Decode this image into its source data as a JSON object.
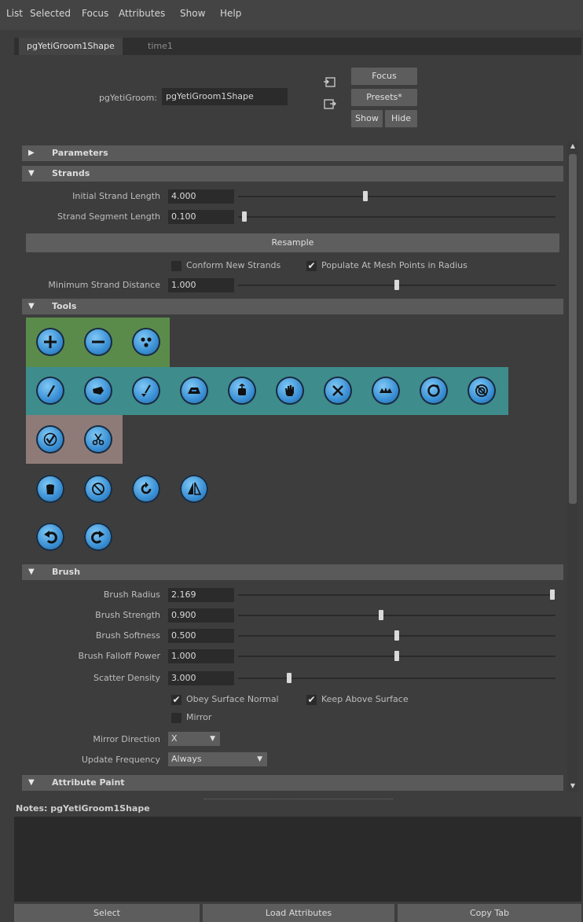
{
  "menu": [
    "List",
    "Selected",
    "Focus",
    "Attributes",
    "Show",
    "Help"
  ],
  "tabs": [
    "pgYetiGroom1Shape",
    "time1"
  ],
  "header": {
    "node_label": "pgYetiGroom:",
    "node_value": "pgYetiGroom1Shape",
    "focus": "Focus",
    "presets": "Presets*",
    "show": "Show",
    "hide": "Hide"
  },
  "sections": {
    "parameters": "Parameters",
    "strands": "Strands",
    "tools": "Tools",
    "brush": "Brush",
    "attribute_paint": "Attribute Paint"
  },
  "strands": {
    "initial_strand_length": {
      "label": "Initial Strand Length",
      "value": "4.000",
      "fraction": 0.4
    },
    "strand_segment_length": {
      "label": "Strand Segment Length",
      "value": "0.100",
      "fraction": 0.02
    },
    "resample": "Resample",
    "conform_new_strands": {
      "label": "Conform New Strands",
      "checked": false
    },
    "populate_at_mesh_points": {
      "label": "Populate At Mesh Points in Radius",
      "checked": true
    },
    "min_strand_distance": {
      "label": "Minimum Strand Distance",
      "value": "1.000",
      "fraction": 0.5
    }
  },
  "tools": {
    "row1": [
      "add-strands-icon",
      "remove-strands-icon",
      "scatter-icon"
    ],
    "row2": [
      "comb-icon",
      "move-icon",
      "sculpt-icon",
      "iron-icon",
      "lift-icon",
      "grab-icon",
      "cut-icon",
      "clump-icon",
      "rotate-icon",
      "twist-icon"
    ],
    "row3": [
      "select-icon",
      "scissors-icon"
    ],
    "row4": [
      "fill-icon",
      "reset-icon",
      "refresh-icon",
      "mirror-icon"
    ],
    "row5": [
      "undo-icon",
      "redo-icon"
    ],
    "colors": {
      "green": "#5b8b4b",
      "teal": "#3e8c8b",
      "mauve": "#8e7b78"
    }
  },
  "brush": {
    "radius": {
      "label": "Brush Radius",
      "value": "2.169",
      "fraction": 0.99
    },
    "strength": {
      "label": "Brush Strength",
      "value": "0.900",
      "fraction": 0.45
    },
    "softness": {
      "label": "Brush Softness",
      "value": "0.500",
      "fraction": 0.5
    },
    "falloff": {
      "label": "Brush Falloff Power",
      "value": "1.000",
      "fraction": 0.5
    },
    "scatter_density": {
      "label": "Scatter Density",
      "value": "3.000",
      "fraction": 0.16
    },
    "obey_surface_normal": {
      "label": "Obey Surface Normal",
      "checked": true
    },
    "keep_above_surface": {
      "label": "Keep Above Surface",
      "checked": true
    },
    "mirror": {
      "label": "Mirror",
      "checked": false
    },
    "mirror_direction": {
      "label": "Mirror Direction",
      "value": "X"
    },
    "update_frequency": {
      "label": "Update Frequency",
      "value": "Always"
    }
  },
  "notes": {
    "label": "Notes:",
    "node": "pgYetiGroom1Shape"
  },
  "bottom": [
    "Select",
    "Load Attributes",
    "Copy Tab"
  ]
}
